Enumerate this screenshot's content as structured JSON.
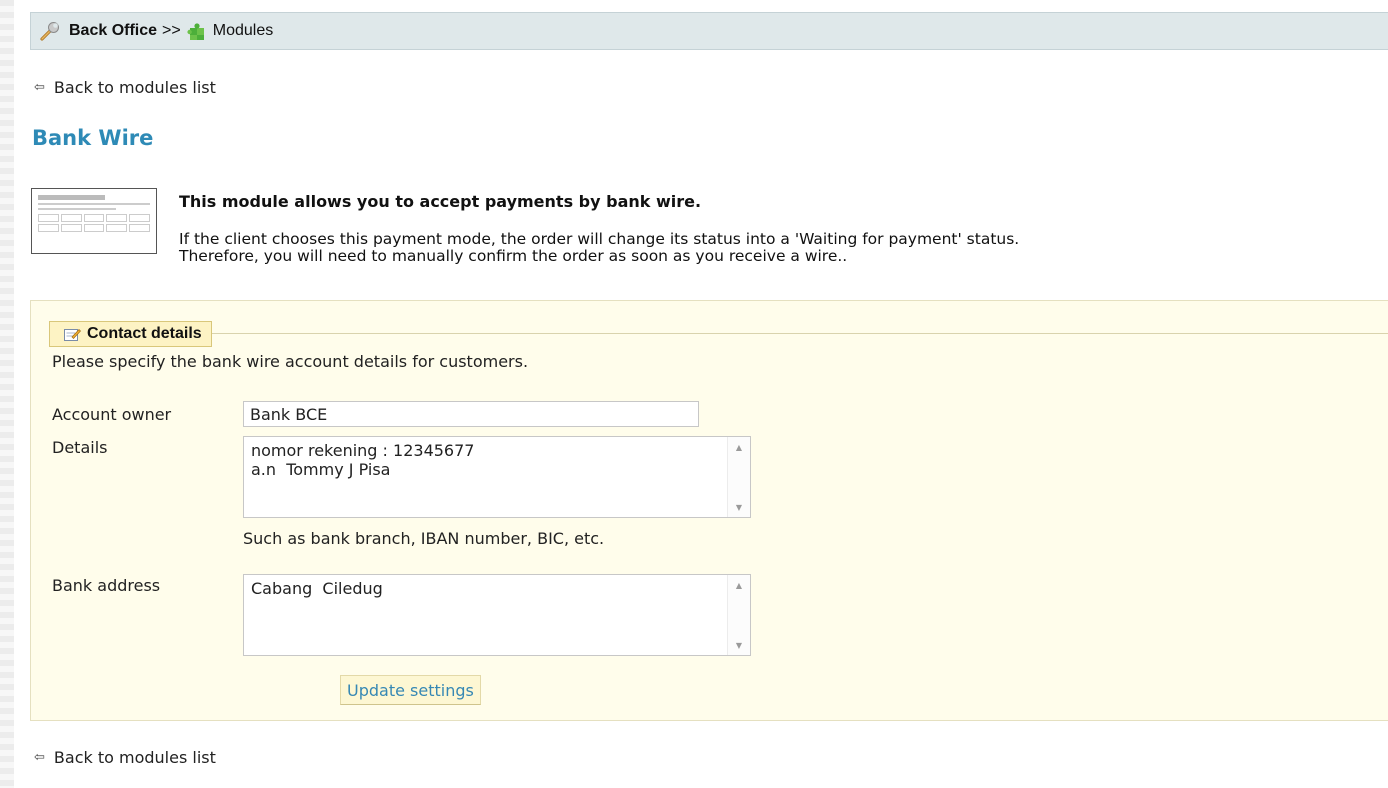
{
  "breadcrumb": {
    "root": "Back Office",
    "separator": ">>",
    "current": "Modules",
    "icons": [
      "wrench-icon",
      "puzzle-icon"
    ]
  },
  "nav": {
    "back_label": "Back to modules list",
    "back_icon": "back-arrow-icon"
  },
  "module": {
    "title": "Bank Wire",
    "summary": "This module allows you to accept payments by bank wire.",
    "description_line1": "If the client chooses this payment mode, the order will change its status into a 'Waiting for payment' status.",
    "description_line2": "Therefore, you will need to manually confirm the order as soon as you receive a wire.."
  },
  "form": {
    "legend": "Contact details",
    "intro": "Please specify the bank wire account details for customers.",
    "owner_label": "Account owner",
    "owner_value": "Bank BCE",
    "details_label": "Details",
    "details_value": "nomor rekening : 12345677\na.n  Tommy J Pisa",
    "details_hint": "Such as bank branch, IBAN number, BIC, etc.",
    "address_label": "Bank address",
    "address_value": "Cabang  Ciledug",
    "submit_label": "Update settings"
  },
  "colors": {
    "title_blue": "#2e8ab6",
    "panel_bg": "#fffdeb",
    "breadcrumb_bg": "#dfe8ea"
  }
}
